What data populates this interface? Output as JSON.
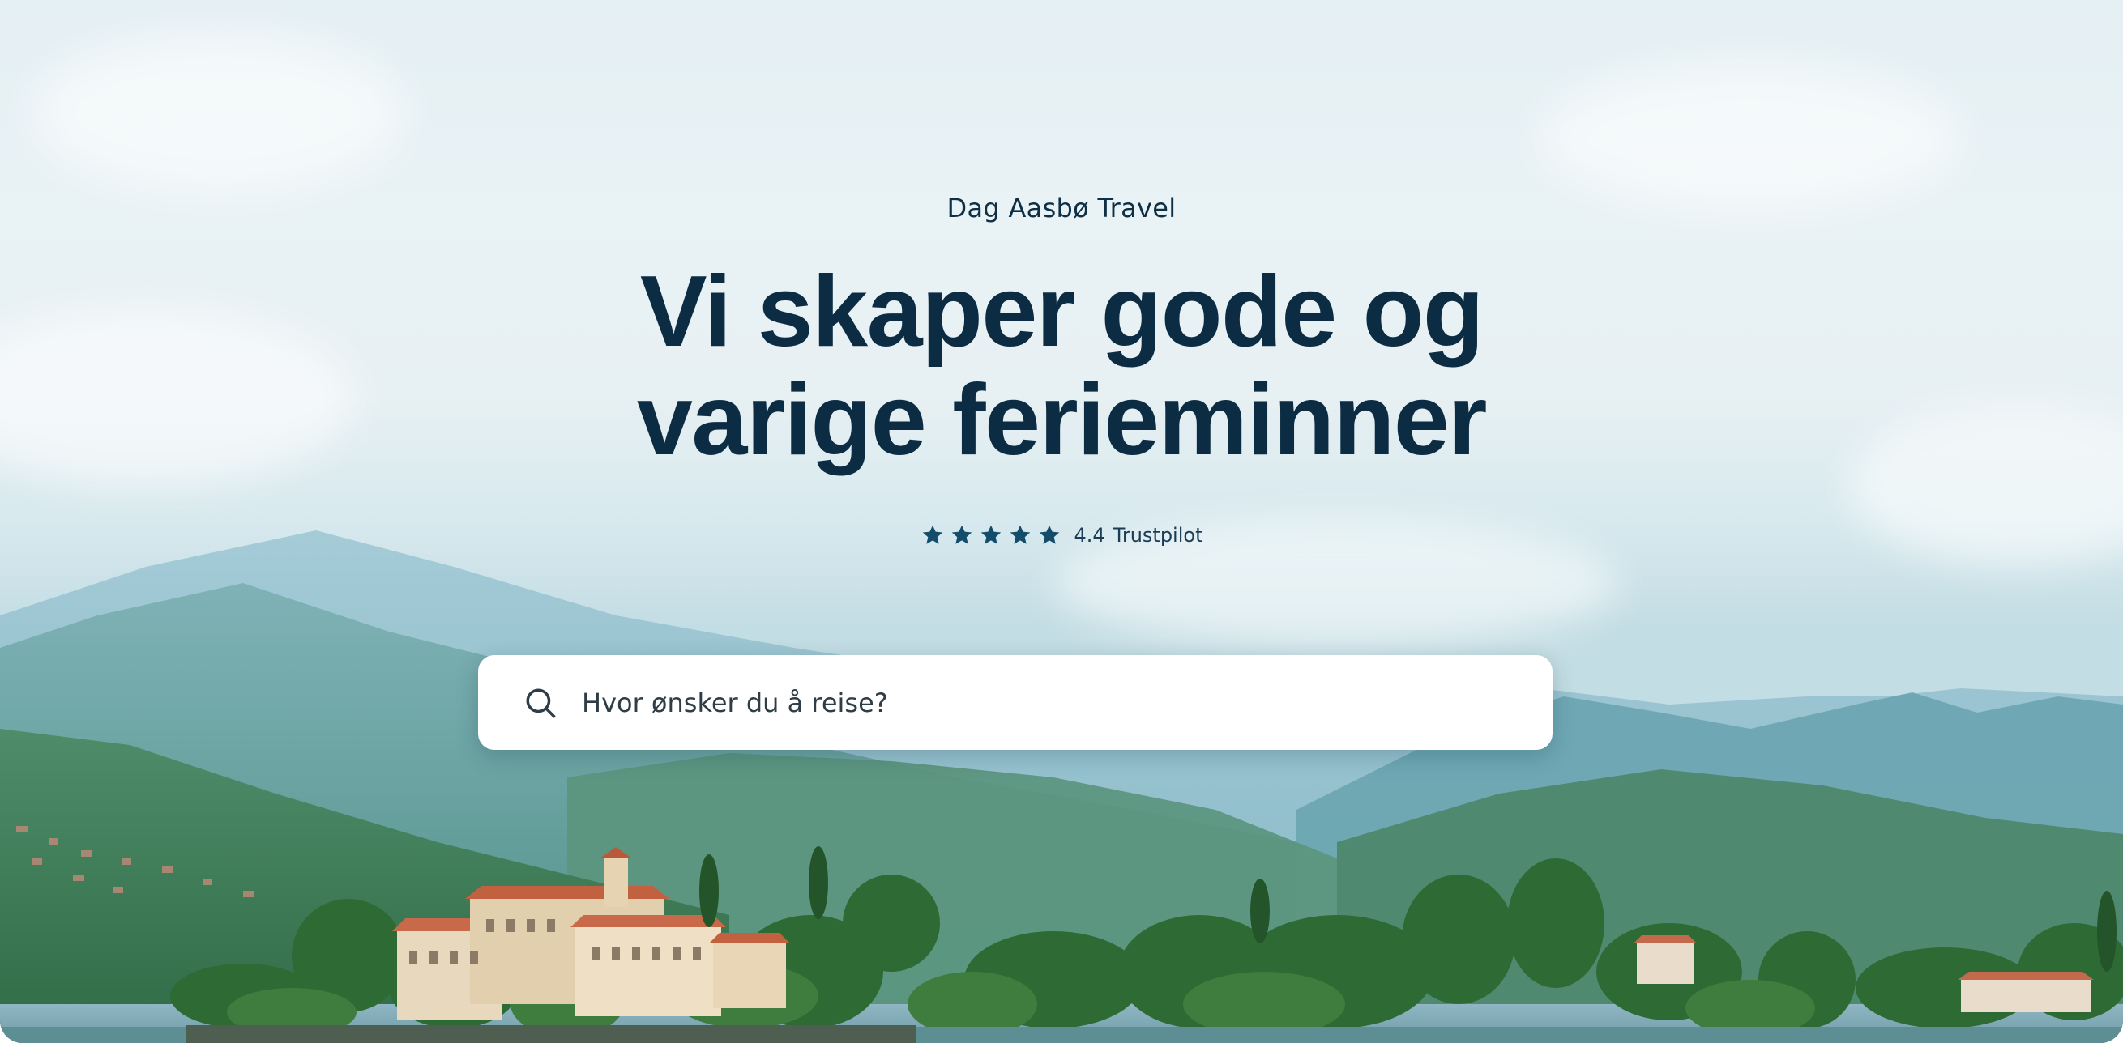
{
  "brand": {
    "name": "Dag Aasbø Travel"
  },
  "hero": {
    "headline_line1": "Vi skaper gode og",
    "headline_line2": "varige ferieminner"
  },
  "rating": {
    "stars": 5,
    "score": "4.4",
    "source": "Trustpilot",
    "star_color": "#134d6b"
  },
  "search": {
    "placeholder": "Hvor ønsker du å reise?",
    "icon": "search-icon"
  },
  "colors": {
    "headline": "#0b2c43",
    "accent": "#134d6b"
  }
}
